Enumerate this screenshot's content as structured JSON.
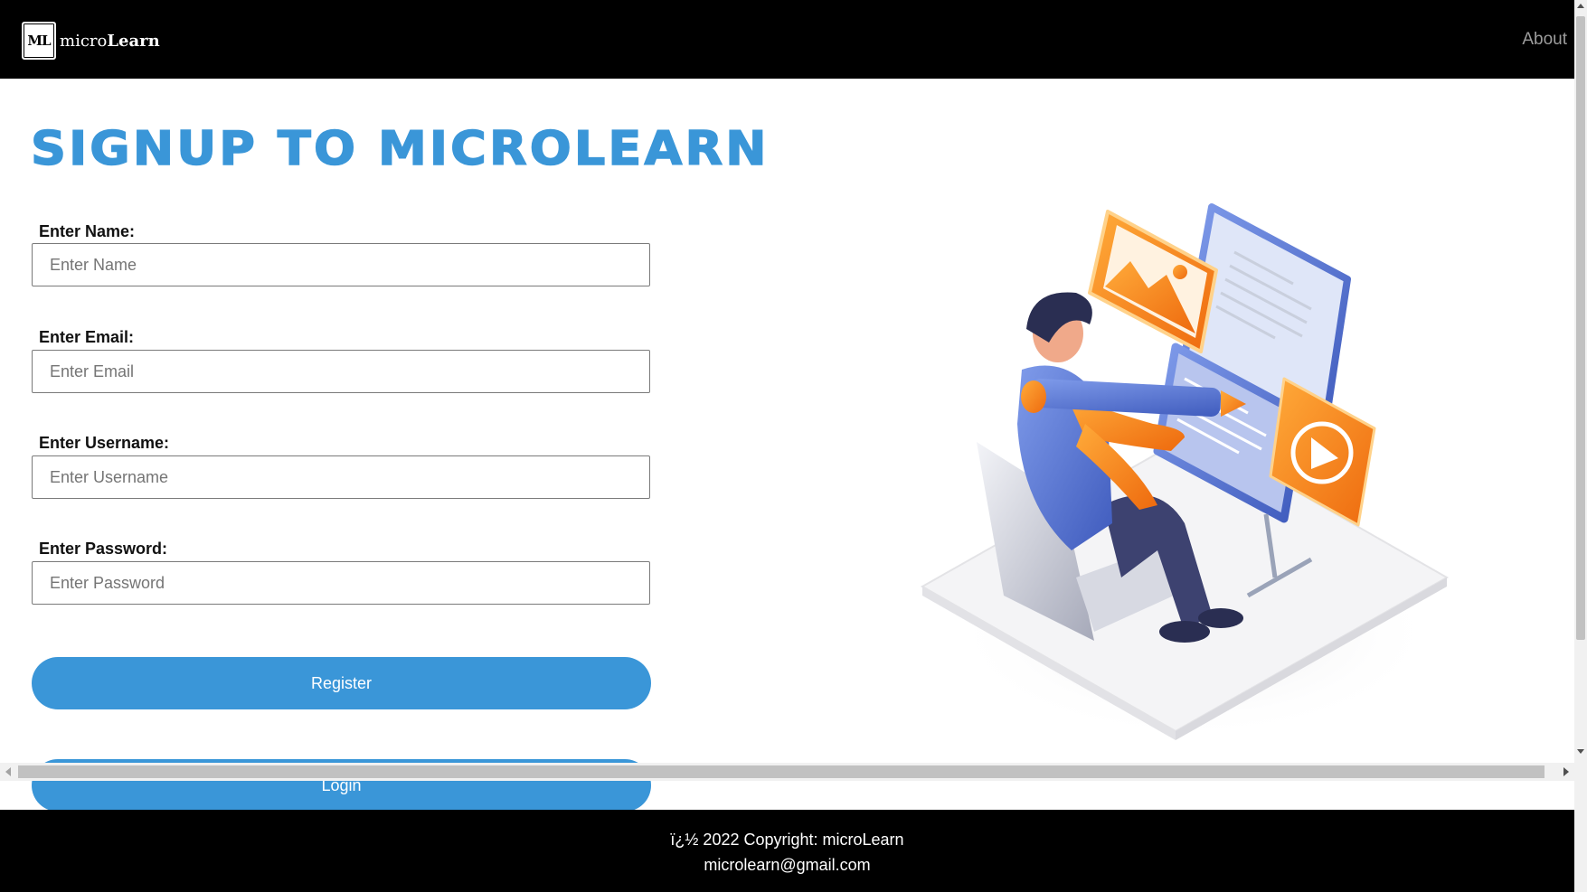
{
  "nav": {
    "logo_text": "ML",
    "brand_prefix": "micro",
    "brand_suffix": "Learn",
    "about_label": "About"
  },
  "form": {
    "title": "Signup to microLearn",
    "name_label": "Enter Name:",
    "name_placeholder": "Enter Name",
    "email_label": "Enter Email:",
    "email_placeholder": "Enter Email",
    "username_label": "Enter Username:",
    "username_placeholder": "Enter Username",
    "password_label": "Enter Password:",
    "password_placeholder": "Enter Password",
    "register_label": "Register",
    "login_label": "Login"
  },
  "footer": {
    "copyright": "ï¿½ 2022 Copyright: microLearn",
    "email": "microlearn@gmail.com"
  },
  "colors": {
    "accent": "#3a96d8",
    "navbar": "#000000",
    "illustration_orange": "#f47e1f",
    "illustration_blue": "#5a7bd8"
  }
}
